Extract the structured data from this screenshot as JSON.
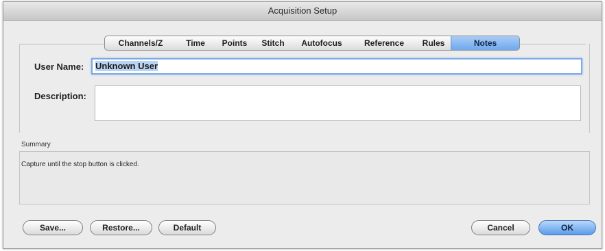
{
  "window": {
    "title": "Acquisition Setup"
  },
  "tabs": [
    {
      "label": "Channels/Z"
    },
    {
      "label": "Time"
    },
    {
      "label": "Points"
    },
    {
      "label": "Stitch"
    },
    {
      "label": "Autofocus"
    },
    {
      "label": "Reference"
    },
    {
      "label": "Rules"
    },
    {
      "label": "Notes",
      "active": true
    }
  ],
  "notes": {
    "user_name_label": "User Name:",
    "user_name_value": "Unknown User",
    "description_label": "Description:",
    "description_value": ""
  },
  "summary": {
    "title": "Summary",
    "text": "Capture until the stop button is clicked."
  },
  "buttons": {
    "save": "Save...",
    "restore": "Restore...",
    "default": "Default",
    "cancel": "Cancel",
    "ok": "OK"
  },
  "colors": {
    "active_tab": "#6fa8ec",
    "focus_ring": "#7da9e4",
    "default_button": "#5a9bea"
  }
}
